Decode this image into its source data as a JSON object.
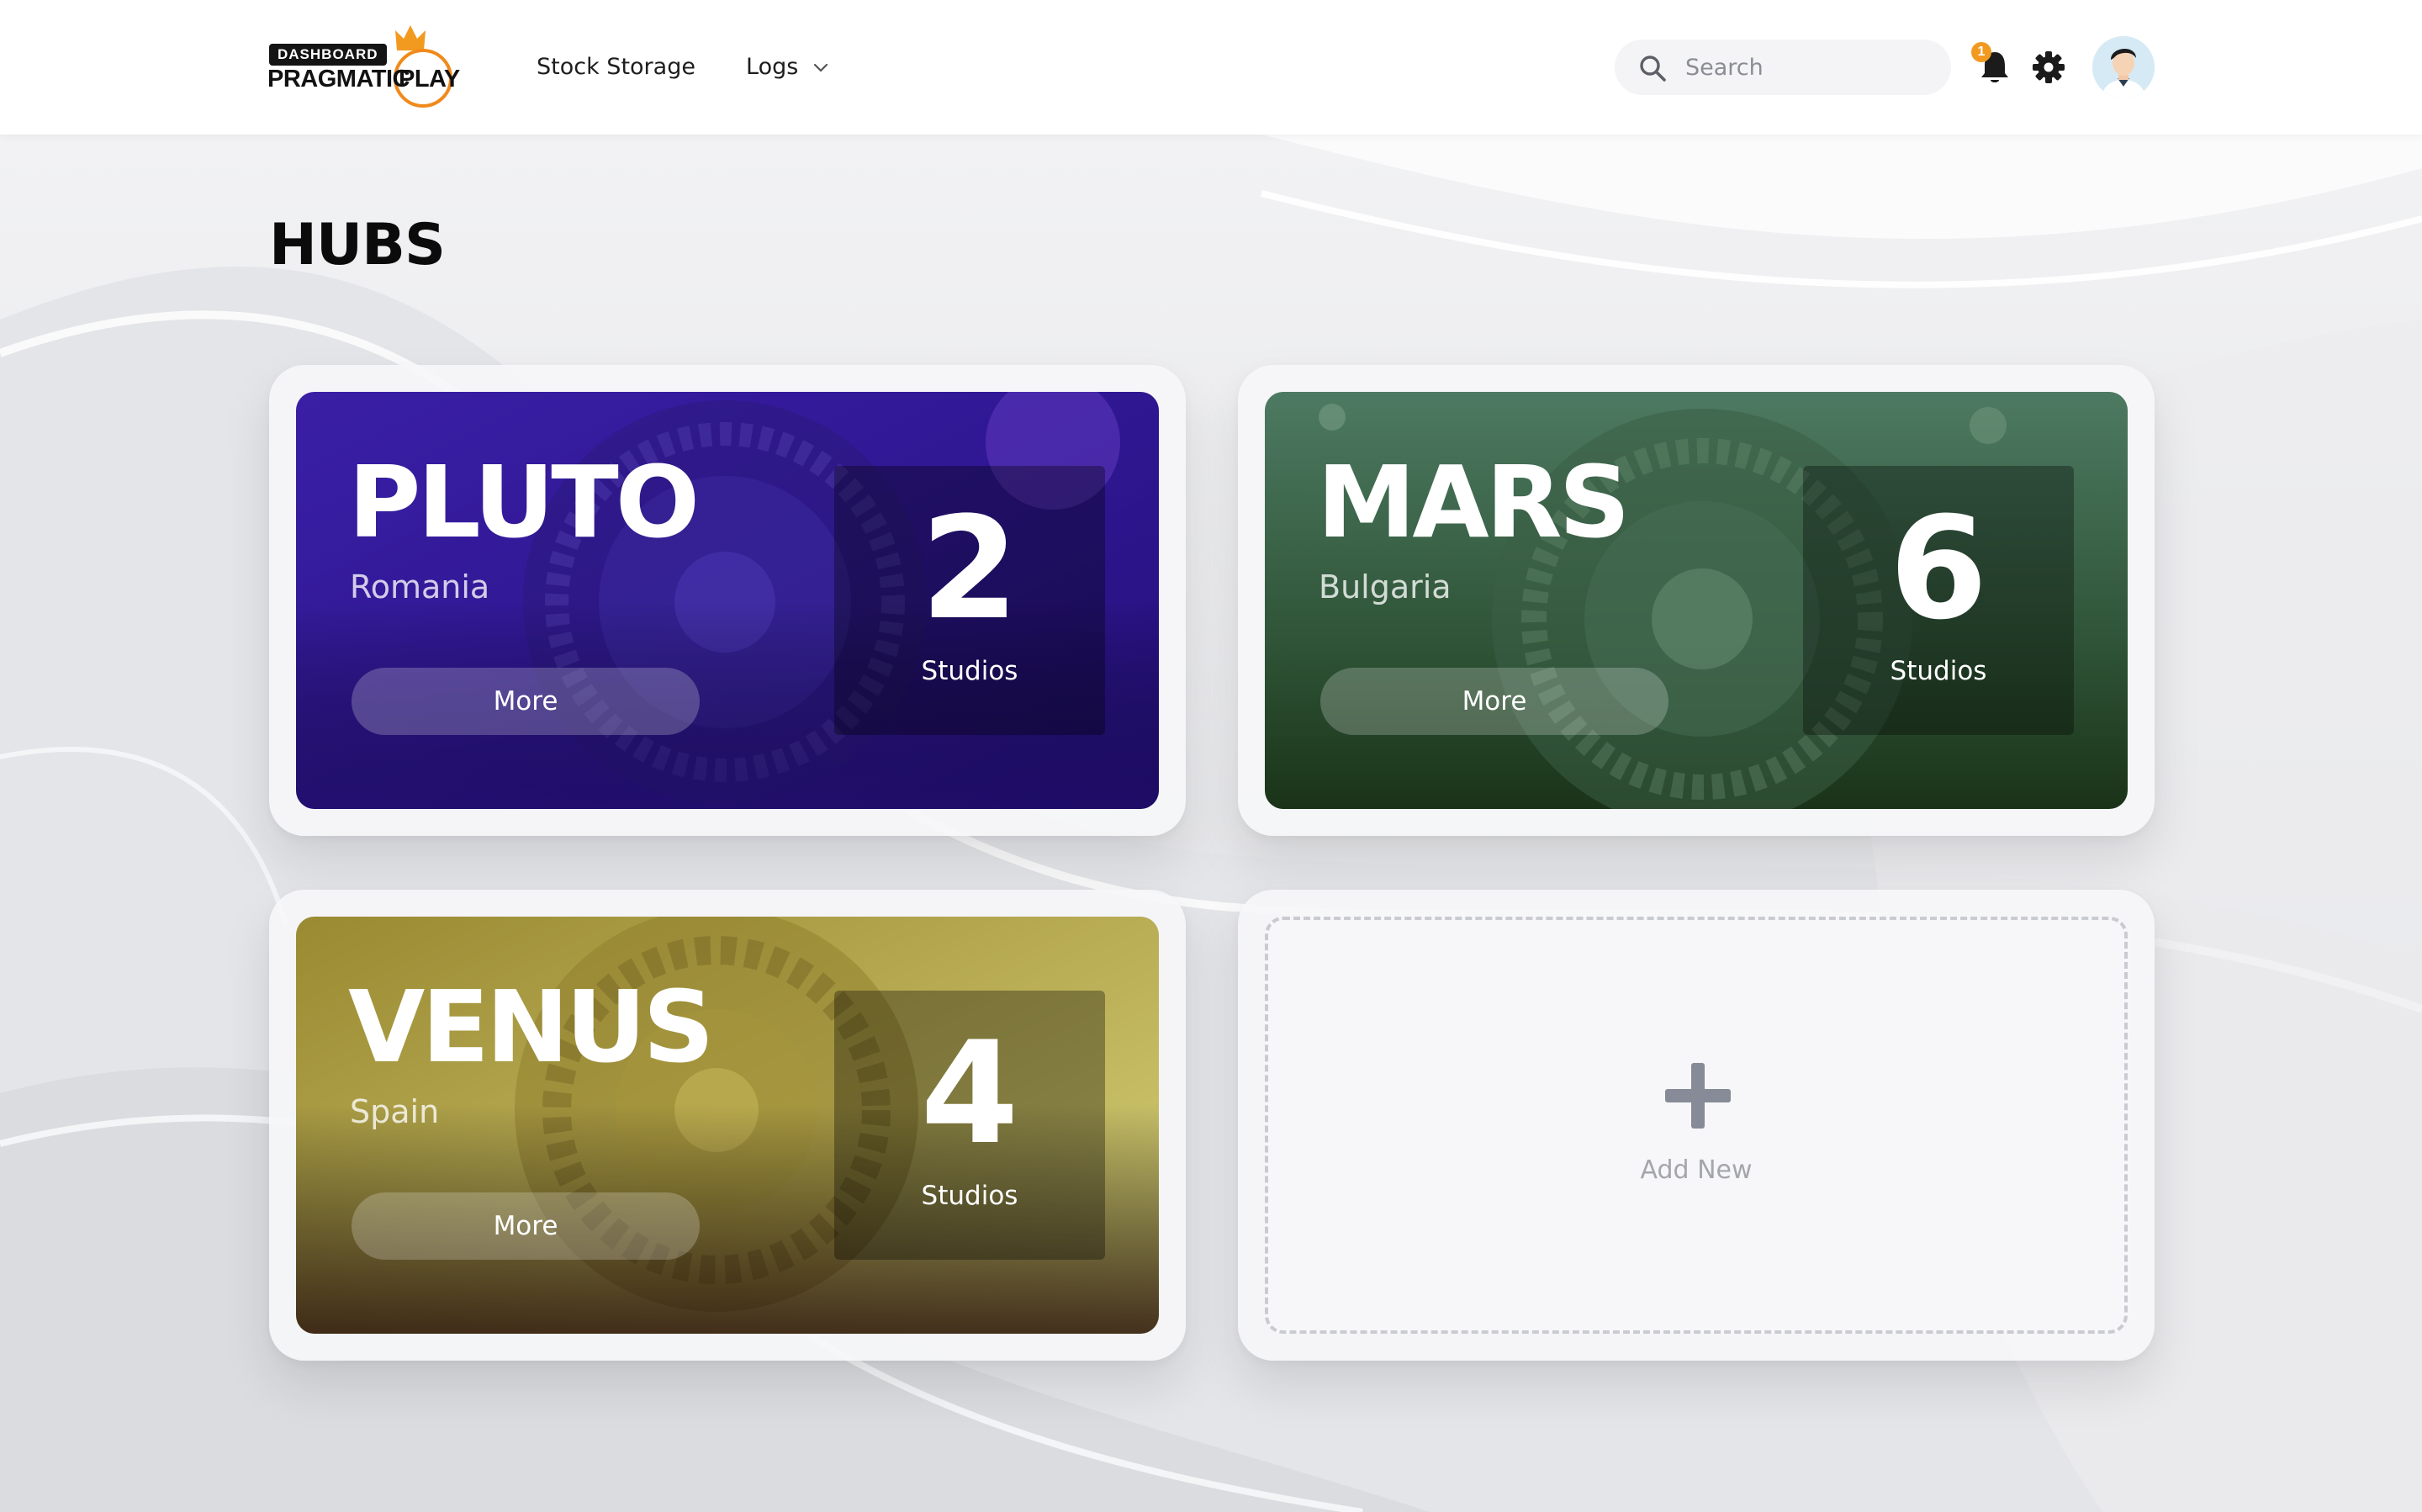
{
  "header": {
    "logo": {
      "badge": "DASHBOARD",
      "brand_part1": "PRAGMATIC",
      "brand_part2": "PLAY"
    },
    "nav": [
      {
        "label": "Stock Storage"
      },
      {
        "label": "Logs",
        "has_dropdown": true
      }
    ],
    "search": {
      "placeholder": "Search",
      "value": ""
    },
    "notifications": {
      "count": "1",
      "icon": "bell-icon"
    },
    "settings_icon": "gear-icon",
    "avatar_icon": "user-avatar"
  },
  "page": {
    "title": "HUBS"
  },
  "hubs": [
    {
      "name": "PLUTO",
      "country": "Romania",
      "count": "2",
      "count_label": "Studios",
      "button": "More",
      "theme": "purple",
      "colors": [
        "#3b1a9c",
        "#2a0f7a"
      ]
    },
    {
      "name": "MARS",
      "country": "Bulgaria",
      "count": "6",
      "count_label": "Studios",
      "button": "More",
      "theme": "green",
      "colors": [
        "#3d6650",
        "#1d3a1c"
      ]
    },
    {
      "name": "VENUS",
      "country": "Spain",
      "count": "4",
      "count_label": "Studios",
      "button": "More",
      "theme": "gold",
      "colors": [
        "#b8a84a",
        "#3b2816"
      ]
    }
  ],
  "add_new": {
    "label": "Add New",
    "icon": "plus-icon"
  },
  "colors": {
    "accent_orange": "#f29a1f",
    "title": "#0b0b0b",
    "muted": "#a4a6ab"
  }
}
